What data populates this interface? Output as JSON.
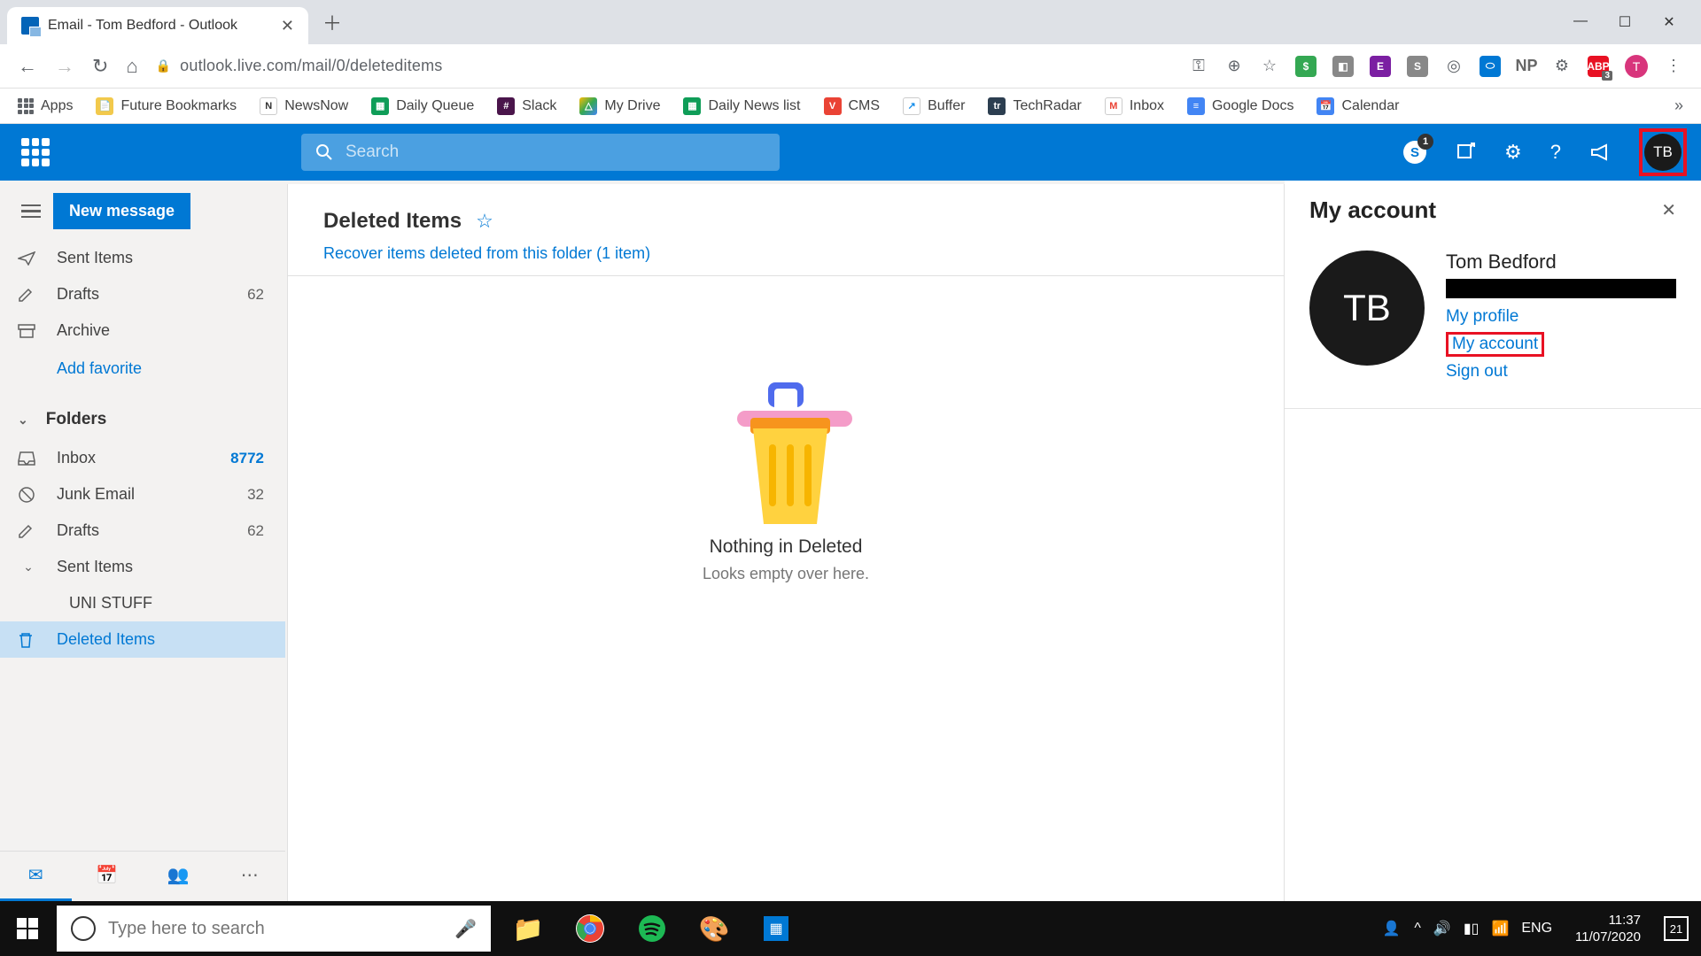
{
  "browser": {
    "tab_title": "Email - Tom Bedford - Outlook",
    "url": "outlook.live.com/mail/0/deleteditems",
    "profile_initial": "T",
    "abp_badge": "3"
  },
  "bookmarks": {
    "apps": "Apps",
    "items": [
      {
        "label": "Future Bookmarks",
        "color": "#f2c94c",
        "abbr": ""
      },
      {
        "label": "NewsNow",
        "color": "#fff",
        "abbr": "N"
      },
      {
        "label": "Daily Queue",
        "color": "#0f9d58",
        "abbr": "+"
      },
      {
        "label": "Slack",
        "color": "#4a154b",
        "abbr": "#"
      },
      {
        "label": "My Drive",
        "color": "#fbbc04",
        "abbr": "△"
      },
      {
        "label": "Daily News list",
        "color": "#0f9d58",
        "abbr": "+"
      },
      {
        "label": "CMS",
        "color": "#ea4335",
        "abbr": "V"
      },
      {
        "label": "Buffer",
        "color": "#168eea",
        "abbr": "↗"
      },
      {
        "label": "TechRadar",
        "color": "#2c3e50",
        "abbr": "tr"
      },
      {
        "label": "Inbox",
        "color": "#ea4335",
        "abbr": "M"
      },
      {
        "label": "Google Docs",
        "color": "#4285f4",
        "abbr": "≡"
      },
      {
        "label": "Calendar",
        "color": "#4285f4",
        "abbr": "10"
      }
    ]
  },
  "outlook_header": {
    "search_placeholder": "Search",
    "skype_count": "1",
    "avatar_initials": "TB"
  },
  "sidebar": {
    "new_message": "New message",
    "favorites": [
      {
        "icon": "send",
        "label": "Sent Items",
        "count": ""
      },
      {
        "icon": "draft",
        "label": "Drafts",
        "count": "62"
      },
      {
        "icon": "archive",
        "label": "Archive",
        "count": ""
      }
    ],
    "add_favorite": "Add favorite",
    "folders_header": "Folders",
    "folders": [
      {
        "icon": "inbox",
        "label": "Inbox",
        "count": "8772",
        "blue": true
      },
      {
        "icon": "junk",
        "label": "Junk Email",
        "count": "32"
      },
      {
        "icon": "draft",
        "label": "Drafts",
        "count": "62"
      },
      {
        "icon": "send-chev",
        "label": "Sent Items",
        "count": ""
      }
    ],
    "subfolder": "UNI STUFF",
    "selected": {
      "icon": "trash",
      "label": "Deleted Items",
      "count": ""
    }
  },
  "main": {
    "title": "Deleted Items",
    "recover_link": "Recover items deleted from this folder (1 item)",
    "empty_title": "Nothing in Deleted",
    "empty_sub": "Looks empty over here."
  },
  "account_pane": {
    "title": "My account",
    "name": "Tom Bedford",
    "avatar_initials": "TB",
    "links": {
      "profile": "My profile",
      "account": "My account",
      "signout": "Sign out"
    }
  },
  "taskbar": {
    "search_placeholder": "Type here to search",
    "lang": "ENG",
    "time": "11:37",
    "date": "11/07/2020",
    "notif_count": "21"
  }
}
